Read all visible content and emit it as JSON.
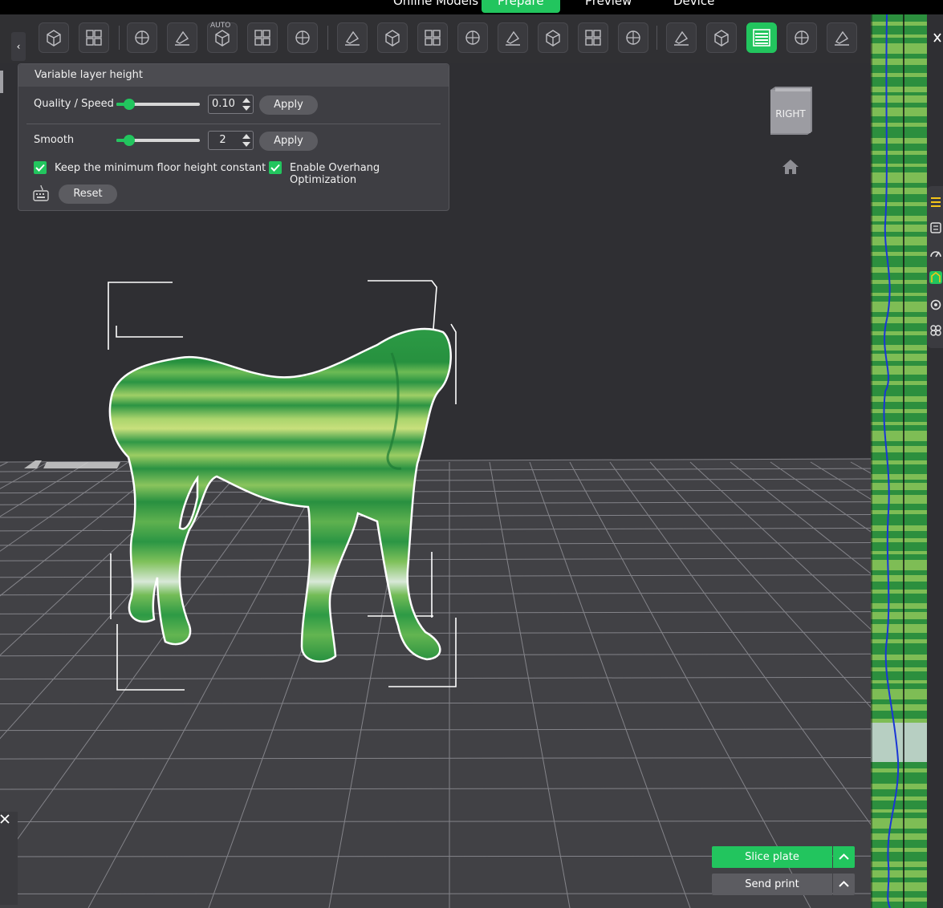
{
  "top_tabs": [
    "Online Models",
    "Prepare",
    "Preview",
    "Device"
  ],
  "active_tab": "Prepare",
  "toolbar": {
    "auto_label": "AUTO",
    "tools": [
      "add-cube-icon",
      "grid-plate-icon",
      "move-icon",
      "rotate-icon",
      "auto-orient-icon",
      "arrange-icon",
      "lay-on-face-icon",
      "split-objects-icon",
      "split-parts-icon",
      "scale-icon",
      "layer-icon",
      "hollow-icon",
      "cut-icon",
      "boolean-icon",
      "measure-icon",
      "support-paint-icon",
      "seam-icon",
      "variable-layer-height-icon",
      "color-paint-icon",
      "fuzzy-skin-icon",
      "assembly-icon"
    ],
    "active_tool": "variable-layer-height-icon"
  },
  "panel": {
    "title": "Variable layer height",
    "quality_label": "Quality / Speed",
    "quality_value": "0.10",
    "quality_slider_fraction": 0.15,
    "smooth_label": "Smooth",
    "smooth_value": "2",
    "smooth_slider_fraction": 0.15,
    "apply_label": "Apply",
    "checkbox1_label": "Keep the minimum floor height constant",
    "checkbox1_checked": true,
    "checkbox2_label": "Enable Overhang Optimization",
    "checkbox2_checked": true,
    "reset_label": "Reset"
  },
  "view_cube": {
    "face_label": "RIGHT"
  },
  "buttons": {
    "slice_label": "Slice plate",
    "send_label": "Send print"
  },
  "colors": {
    "accent": "#22c55e",
    "background": "#2f2f33",
    "panel": "#3e3e43"
  }
}
